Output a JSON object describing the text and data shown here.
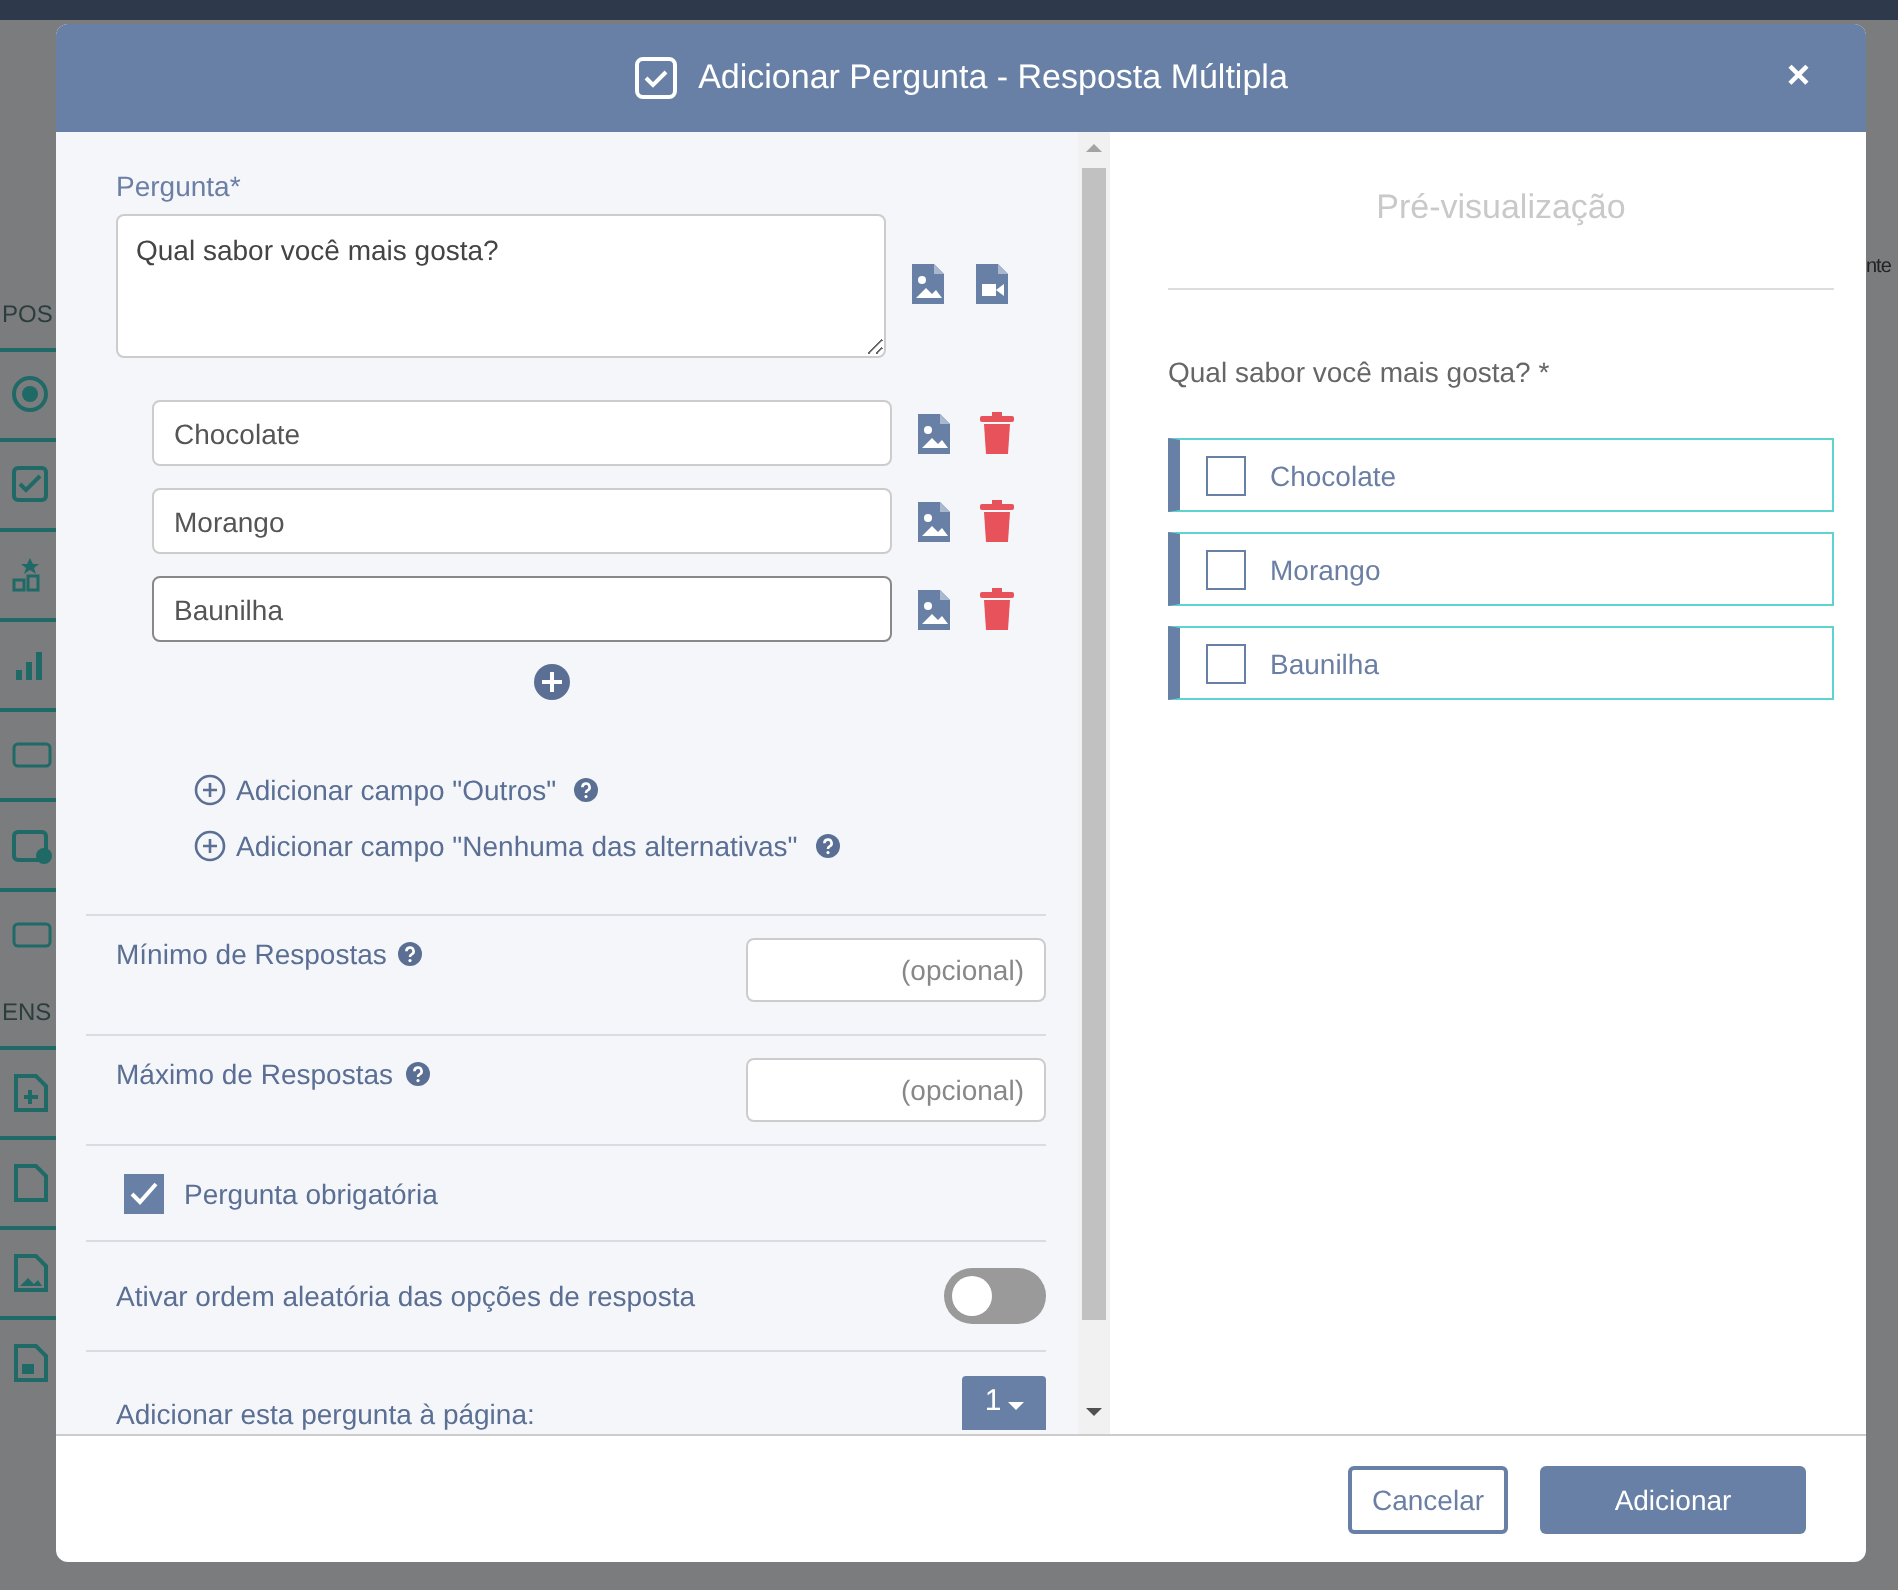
{
  "background": {
    "section_headings": [
      "POS",
      "ENS"
    ],
    "right_fragment": "nte"
  },
  "dialog": {
    "title": "Adicionar Pergunta - Resposta Múltipla",
    "close": "×"
  },
  "editor": {
    "question_label": "Pergunta*",
    "question": "Qual sabor você mais gosta?",
    "options": [
      {
        "value": "Chocolate",
        "focused": false
      },
      {
        "value": "Morango",
        "focused": false
      },
      {
        "value": "Baunilha",
        "focused": true
      }
    ],
    "extra_links": [
      "Adicionar campo \"Outros\"",
      "Adicionar campo \"Nenhuma das alternativas\""
    ],
    "settings": [
      {
        "kind": "number",
        "label": "Mínimo de Respostas",
        "placeholder": "(opcional)"
      },
      {
        "kind": "number",
        "label": "Máximo de Respostas",
        "placeholder": "(opcional)"
      },
      {
        "kind": "checkbox",
        "label": "Pergunta obrigatória",
        "checked": true
      },
      {
        "kind": "toggle",
        "label": "Ativar ordem aleatória das opções de resposta",
        "on": false
      },
      {
        "kind": "select",
        "label": "Adicionar esta pergunta à página:",
        "value": "1"
      }
    ]
  },
  "preview": {
    "title": "Pré-visualização",
    "question": "Qual sabor você mais gosta? *",
    "options": [
      {
        "label": "Chocolate",
        "checked": false
      },
      {
        "label": "Morango",
        "checked": false
      },
      {
        "label": "Baunilha",
        "checked": false
      }
    ]
  },
  "buttons": [
    {
      "label": "Cancelar",
      "kind": "secondary"
    },
    {
      "label": "Adicionar",
      "kind": "primary"
    }
  ]
}
